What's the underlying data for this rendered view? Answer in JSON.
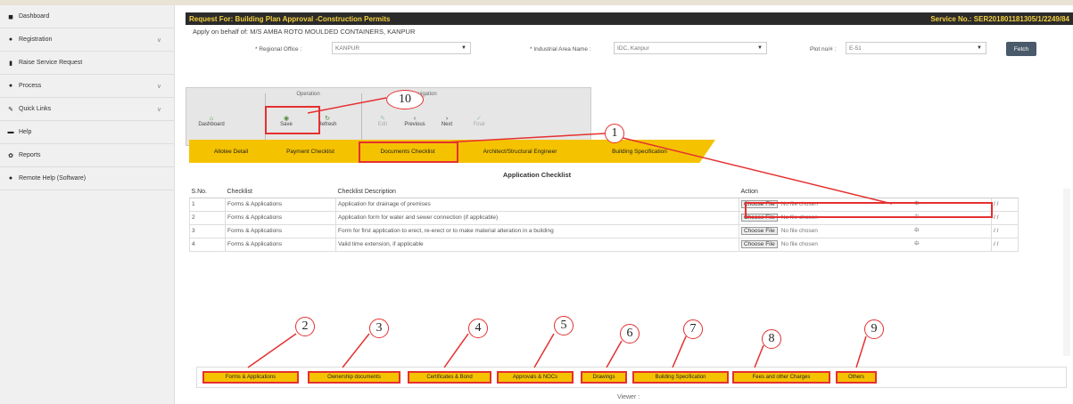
{
  "sidebar": {
    "items": [
      {
        "label": "Dashboard",
        "icon": "dashboard-icon",
        "has_chevron": false
      },
      {
        "label": "Registration",
        "icon": "registration-icon",
        "has_chevron": true
      },
      {
        "label": "Raise Service Request",
        "icon": "document-icon",
        "has_chevron": false
      },
      {
        "label": "Process",
        "icon": "process-icon",
        "has_chevron": true
      },
      {
        "label": "Quick Links",
        "icon": "link-icon",
        "has_chevron": true
      },
      {
        "label": "Help",
        "icon": "help-icon",
        "has_chevron": false
      },
      {
        "label": "Reports",
        "icon": "reports-icon",
        "has_chevron": false
      },
      {
        "label": "Remote Help (Software)",
        "icon": "remote-help-icon",
        "has_chevron": false
      }
    ]
  },
  "header": {
    "title": "Request For: Building Plan Approval -Construction Permits",
    "service_no": "Service No.: SER201801181305/1/2249/84"
  },
  "behalf": "Apply on behalf of: M/S AMBA ROTO MOULDED CONTAINERS, KANPUR",
  "filters": {
    "regional_office_label": "* Regional Office :",
    "regional_office_value": "KANPUR",
    "industrial_area_label": "* Industrial Area Name :",
    "industrial_area_value": "IDC, Kanpur",
    "plot_label": "Plot no/# :",
    "plot_value": "E-51",
    "fetch_label": "Fetch"
  },
  "toolbar": {
    "group1_title": "Operation",
    "group2_title": "Navigation",
    "dashboard": "Dashboard",
    "save": "Save",
    "refresh": "Refresh",
    "edit": "Edit",
    "previous": "Previous",
    "next": "Next",
    "final": "Final"
  },
  "tabs": [
    "Allotee Detail",
    "Payment Checklist",
    "Documents Checklist",
    "Architect/Structural Engineer",
    "Building Specification"
  ],
  "section_title": "Application Checklist",
  "table": {
    "headers": [
      "S.No.",
      "Checklist",
      "Checklist Description",
      "Action"
    ],
    "rows": [
      {
        "sno": "1",
        "checklist": "Forms & Applications",
        "desc": "Application for drainage of premises"
      },
      {
        "sno": "2",
        "checklist": "Forms & Applications",
        "desc": "Application form for water and sewer connection (if applicable)"
      },
      {
        "sno": "3",
        "checklist": "Forms & Applications",
        "desc": "Form for first application to erect, re-erect or to make material alteration in a building"
      },
      {
        "sno": "4",
        "checklist": "Forms & Applications",
        "desc": "Valid time extension, if applicable"
      }
    ],
    "choose_label": "Choose File",
    "nofile_label": "No file chosen",
    "slash": "/ /"
  },
  "bottom_tabs": [
    "Forms & Applications",
    "Ownership documents",
    "Certificates & Bond",
    "Approvals & NOCs",
    "Drawings",
    "Building Specification",
    "Fees and other Charges",
    "Others"
  ],
  "viewer_label": "Viewer :",
  "callouts": [
    "1",
    "2",
    "3",
    "4",
    "5",
    "6",
    "7",
    "8",
    "9",
    "10"
  ],
  "colors": {
    "accent": "#f5c200",
    "highlight": "#e53030",
    "titlebar": "#2b2b2b"
  }
}
